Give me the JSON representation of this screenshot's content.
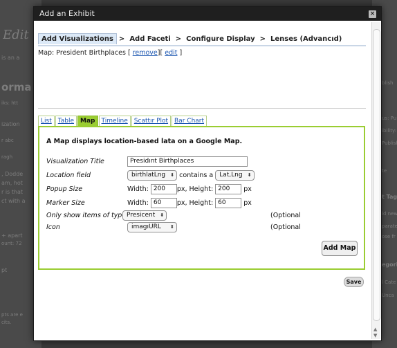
{
  "background": {
    "left_texts": [
      "Edit",
      "is an a",
      "orma",
      "iks: htt",
      "ization",
      "r   abc",
      "ragh",
      ", Dodde",
      "am, hot",
      "r is that",
      "ct with a",
      "+ apart",
      "ount: 72",
      "pt",
      "pts are e",
      "cits."
    ],
    "right_texts": [
      "blish",
      "us: Pu",
      "ibility: P",
      "Publish",
      "te",
      "t Tag",
      "ld new",
      "parate",
      "ose fr",
      "egori",
      "l Cate",
      "Unca"
    ]
  },
  "modal": {
    "title": "Add an Exhibit",
    "close_icon": "×",
    "wizard_tabs": [
      {
        "label": "Add Visualizations",
        "active": true
      },
      {
        "label": "Add Faceti",
        "active": false
      },
      {
        "label": "Configure Display",
        "active": false
      },
      {
        "label": "Lenses (Advancıd)",
        "active": false
      }
    ],
    "wizard_separator": ">",
    "subtitle_prefix": "Map: President Birthplaces [",
    "remove_label": "remove",
    "subtitle_mid": "][",
    "edit_label": "edit",
    "subtitle_suffix": "]",
    "view_tabs": [
      {
        "label": "List",
        "active": false
      },
      {
        "label": "Table",
        "active": false
      },
      {
        "label": "Map",
        "active": true
      },
      {
        "label": "Timeline",
        "active": false
      },
      {
        "label": "Scattır Plot",
        "active": false
      },
      {
        "label": "Bar Chart",
        "active": false
      }
    ],
    "panel": {
      "description": "A Map displays location-based lata on a Google Map.",
      "title_label": "Visualization Title",
      "title_value": "Presidınt Birthplaces",
      "location_label": "Location field",
      "location_value": "birthlatLng",
      "contains_text": "contains a",
      "contains_value": "Lat,Lng",
      "popup_label": "Popup Size",
      "popup_width_label": "Width:",
      "popup_width": "200",
      "popup_px1": "px, Height:",
      "popup_height": "200",
      "popup_px2": "px",
      "marker_label": "Marker Size",
      "marker_width_label": "Width:",
      "marker_width": "60",
      "marker_px1": "px, Height:",
      "marker_height": "60",
      "marker_px2": "px",
      "only_show_label": "Only show items of type",
      "only_show_value": "Presicent",
      "only_show_optional": "(Optional",
      "icon_label": "Icon",
      "icon_value": "imagıURL",
      "icon_optional": "(Optional",
      "add_map_label": "Add Map"
    },
    "save_label": "Save"
  }
}
